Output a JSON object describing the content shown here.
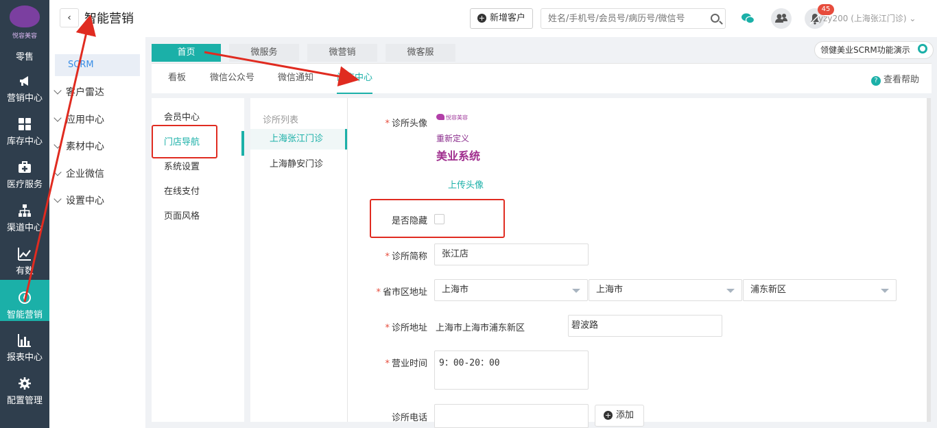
{
  "app": {
    "brand_caption": "悦容美容",
    "page_title": "智能营销",
    "back_symbol": "‹"
  },
  "rail": [
    {
      "name": "retail",
      "label": "零售",
      "icon": "shopping-icon"
    },
    {
      "name": "marketing",
      "label": "营销中心",
      "icon": "megaphone-icon"
    },
    {
      "name": "inventory",
      "label": "库存中心",
      "icon": "grid-icon"
    },
    {
      "name": "medical",
      "label": "医疗服务",
      "icon": "medkit-icon"
    },
    {
      "name": "channel",
      "label": "渠道中心",
      "icon": "sitemap-icon"
    },
    {
      "name": "data",
      "label": "有数",
      "icon": "trend-icon"
    },
    {
      "name": "smart",
      "label": "智能营销",
      "icon": "compass-icon"
    },
    {
      "name": "report",
      "label": "报表中心",
      "icon": "bar-chart-icon"
    },
    {
      "name": "config",
      "label": "配置管理",
      "icon": "gear-icon"
    }
  ],
  "subnav": {
    "top": "SCRM",
    "items": [
      "客户雷达",
      "应用中心",
      "素材中心",
      "企业微信",
      "设置中心"
    ]
  },
  "header": {
    "new_customer": "新增客户",
    "search_placeholder": "姓名/手机号/会员号/病历号/微信号",
    "notif_count": "45",
    "user": "yzy200 (上海张江门诊)"
  },
  "tabs": [
    "首页",
    "微服务",
    "微营销",
    "微客服"
  ],
  "top_help": "领健美业SCRM功能演示",
  "tabs2": [
    "看板",
    "微信公众号",
    "微信通知",
    "门店中心"
  ],
  "help": "查看帮助",
  "left_menu": [
    "会员中心",
    "门店导航",
    "系统设置",
    "在线支付",
    "页面风格"
  ],
  "clinic_list": {
    "title": "诊所列表",
    "items": [
      "上海张江门诊",
      "上海静安门诊"
    ]
  },
  "form": {
    "avatar_label": "诊所头像",
    "logo_small": "悦容美容",
    "logo_line1": "重新定义",
    "logo_line2": "美业系统",
    "upload": "上传头像",
    "hidden_label": "是否隐藏",
    "short_name_label": "诊所简称",
    "short_name": "张江店",
    "region_label": "省市区地址",
    "province": "上海市",
    "city": "上海市",
    "district": "浦东新区",
    "address_label": "诊所地址",
    "address_prefix": "上海市上海市浦东新区",
    "street": "碧波路",
    "hours_label": "营业时间",
    "hours": "9：00-20：00",
    "phone_label": "诊所电话",
    "phone": "",
    "add": "添加"
  },
  "colors": {
    "accent": "#1bb0a8",
    "rail": "#2f3e4d",
    "annotation": "#e02b20"
  }
}
